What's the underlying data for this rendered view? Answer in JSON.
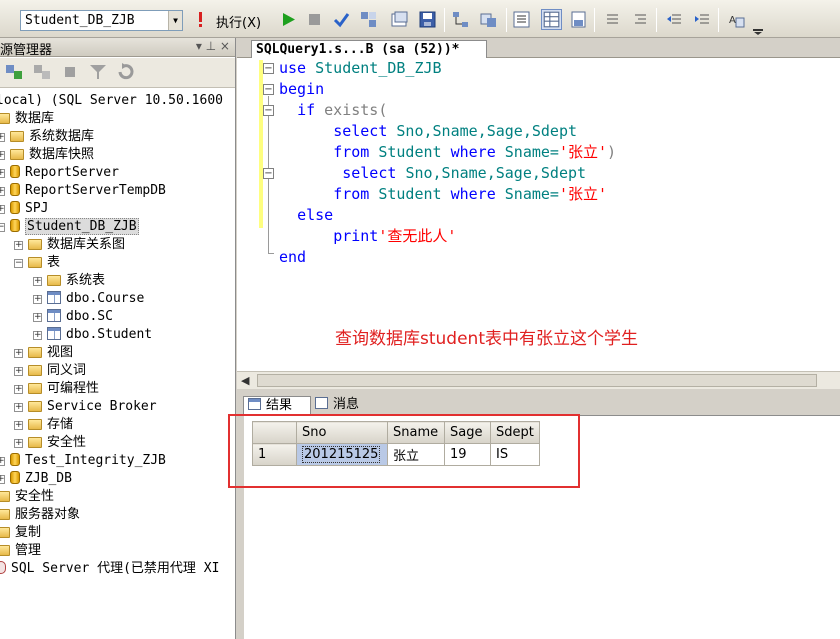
{
  "toolbar": {
    "database_selector": "Student_DB_ZJB",
    "execute_label": "执行(X)"
  },
  "object_explorer": {
    "title": "源管理器",
    "title_buttons": "▾ ⊥ ×",
    "tree": [
      {
        "label": "local) (SQL Server 10.50.1600",
        "level": 0,
        "expander": "",
        "icon": "server-icon"
      },
      {
        "label": "数据库",
        "level": 0,
        "expander": "",
        "icon": "folder-icon"
      },
      {
        "label": "系统数据库",
        "level": 0,
        "expander": "+",
        "icon": "folder-icon"
      },
      {
        "label": "数据库快照",
        "level": 0,
        "expander": "+",
        "icon": "folder-icon"
      },
      {
        "label": "ReportServer",
        "level": 0,
        "expander": "+",
        "icon": "database-icon"
      },
      {
        "label": "ReportServerTempDB",
        "level": 0,
        "expander": "+",
        "icon": "database-icon"
      },
      {
        "label": "SPJ",
        "level": 0,
        "expander": "+",
        "icon": "database-icon"
      },
      {
        "label": "Student_DB_ZJB",
        "level": 0,
        "expander": "−",
        "icon": "database-icon",
        "selected": true
      },
      {
        "label": "数据库关系图",
        "level": 1,
        "expander": "+",
        "icon": "folder-icon"
      },
      {
        "label": "表",
        "level": 1,
        "expander": "−",
        "icon": "folder-icon"
      },
      {
        "label": "系统表",
        "level": 2,
        "expander": "+",
        "icon": "folder-icon"
      },
      {
        "label": "dbo.Course",
        "level": 2,
        "expander": "+",
        "icon": "table-icon"
      },
      {
        "label": "dbo.SC",
        "level": 2,
        "expander": "+",
        "icon": "table-icon"
      },
      {
        "label": "dbo.Student",
        "level": 2,
        "expander": "+",
        "icon": "table-icon"
      },
      {
        "label": "视图",
        "level": 1,
        "expander": "+",
        "icon": "folder-icon"
      },
      {
        "label": "同义词",
        "level": 1,
        "expander": "+",
        "icon": "folder-icon"
      },
      {
        "label": "可编程性",
        "level": 1,
        "expander": "+",
        "icon": "folder-icon"
      },
      {
        "label": "Service Broker",
        "level": 1,
        "expander": "+",
        "icon": "folder-icon"
      },
      {
        "label": "存储",
        "level": 1,
        "expander": "+",
        "icon": "folder-icon"
      },
      {
        "label": "安全性",
        "level": 1,
        "expander": "+",
        "icon": "folder-icon"
      },
      {
        "label": "Test_Integrity_ZJB",
        "level": 0,
        "expander": "+",
        "icon": "database-icon"
      },
      {
        "label": "ZJB_DB",
        "level": 0,
        "expander": "+",
        "icon": "database-icon"
      },
      {
        "label": "安全性",
        "level": -1,
        "expander": "",
        "icon": "folder-icon"
      },
      {
        "label": "服务器对象",
        "level": -1,
        "expander": "",
        "icon": "folder-icon"
      },
      {
        "label": "复制",
        "level": -1,
        "expander": "",
        "icon": "folder-icon"
      },
      {
        "label": "管理",
        "level": -1,
        "expander": "",
        "icon": "folder-icon"
      },
      {
        "label": "SQL Server 代理(已禁用代理 XI",
        "level": -1,
        "expander": "",
        "icon": "agent-icon"
      }
    ]
  },
  "editor": {
    "tab_title": "SQLQuery1.s...B (sa (52))*",
    "code": {
      "l1_kw": "use",
      "l1_id": "Student_DB_ZJB",
      "l2_kw": "begin",
      "l3_kw": "if",
      "l3_gray": "exists(",
      "l4_kw": "select",
      "l4_id": "Sno,Sname,Sage,Sdept",
      "l5_kw1": "from",
      "l5_id1": "Student",
      "l5_kw2": "where",
      "l5_id2": "Sname=",
      "l5_str": "'张立'",
      "l5_tail": ")",
      "l6_kw": "select",
      "l6_id": "Sno,Sname,Sage,Sdept",
      "l7_kw1": "from",
      "l7_id1": "Student",
      "l7_kw2": "where",
      "l7_id2": "Sname=",
      "l7_str": "'张立'",
      "l8_kw": "else",
      "l9_kw": "print",
      "l9_str": "'查无此人'",
      "l10_kw": "end"
    },
    "annotation": "查询数据库student表中有张立这个学生"
  },
  "results": {
    "tab_results": "结果",
    "tab_messages": "消息",
    "columns": [
      "Sno",
      "Sname",
      "Sage",
      "Sdept"
    ],
    "rows": [
      {
        "num": "1",
        "Sno": "201215125",
        "Sname": "张立",
        "Sage": "19",
        "Sdept": "IS"
      }
    ]
  },
  "colors": {
    "keyword": "#0000ff",
    "identifier": "#008080",
    "string": "#ff0000",
    "annotation": "#e02020",
    "highlight_box": "#e23030"
  }
}
